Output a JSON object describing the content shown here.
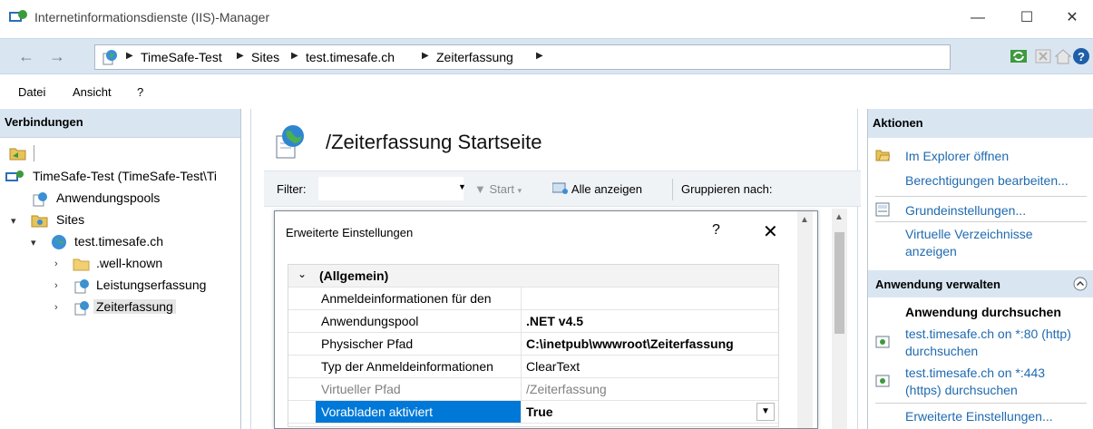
{
  "window": {
    "title": "Internetinformationsdienste (IIS)-Manager",
    "minimize": "—",
    "maximize": "☐",
    "close": "✕"
  },
  "address": {
    "back": "←",
    "forward": "→",
    "crumbs": [
      "TimeSafe-Test",
      "Sites",
      "test.timesafe.ch",
      "Zeiterfassung"
    ],
    "separator": "▶"
  },
  "menu": [
    "Datei",
    "Ansicht",
    "?"
  ],
  "connections": {
    "header": "Verbindungen",
    "tree": [
      {
        "label": "TimeSafe-Test (TimeSafe-Test\\Ti"
      },
      {
        "label": "Anwendungspools"
      },
      {
        "label": "Sites"
      },
      {
        "label": "test.timesafe.ch"
      },
      {
        "label": ".well-known"
      },
      {
        "label": "Leistungserfassung"
      },
      {
        "label": "Zeiterfassung"
      }
    ]
  },
  "main": {
    "title": "/Zeiterfassung Startseite",
    "filter_label": "Filter:",
    "filter_value": "",
    "start_label": "Start",
    "show_all_label": "Alle anzeigen",
    "group_label": "Gruppieren nach:"
  },
  "dialog": {
    "title": "Erweiterte Einstellungen",
    "help": "?",
    "close": "✕",
    "category": "(Allgemein)",
    "rows": [
      {
        "key": "Anmeldeinformationen für den",
        "value": ""
      },
      {
        "key": "Anwendungspool",
        "value": ".NET v4.5"
      },
      {
        "key": "Physischer Pfad",
        "value": "C:\\inetpub\\wwwroot\\Zeiterfassung"
      },
      {
        "key": "Typ der Anmeldeinformationen",
        "value": "ClearText"
      },
      {
        "key": "Virtueller Pfad",
        "value": "/Zeiterfassung"
      },
      {
        "key": "Vorabladen aktiviert",
        "value": "True"
      }
    ]
  },
  "actions": {
    "header": "Aktionen",
    "items_top": [
      {
        "label": "Im Explorer öffnen"
      },
      {
        "label": "Berechtigungen bearbeiten..."
      },
      {
        "label": "Grundeinstellungen..."
      },
      {
        "label": "Virtuelle Verzeichnisse"
      },
      {
        "label": "anzeigen"
      }
    ],
    "section": "Anwendung verwalten",
    "browse_header": "Anwendung durchsuchen",
    "browse": [
      {
        "line1": "test.timesafe.ch on *:80 (http)",
        "line2": "durchsuchen"
      },
      {
        "line1": "test.timesafe.ch on *:443",
        "line2": "(https) durchsuchen"
      }
    ],
    "advanced": "Erweiterte Einstellungen..."
  }
}
